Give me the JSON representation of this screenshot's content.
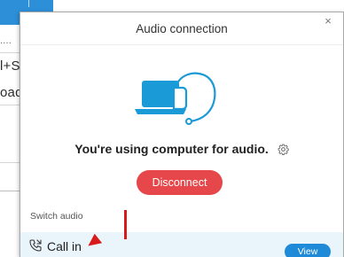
{
  "background": {
    "dots": "....",
    "line1": "l+S",
    "line2": "oad"
  },
  "dialog": {
    "title": "Audio connection",
    "close_glyph": "×",
    "status_text": "You're using computer for audio.",
    "disconnect_label": "Disconnect",
    "switch_audio_label": "Switch audio",
    "call_in_label": "Call in",
    "view_label": "View"
  },
  "icons": {
    "close": "close-icon",
    "gear": "gear-icon",
    "phone": "phone-icon",
    "illustration": "computer-headset-icon"
  },
  "colors": {
    "header_blue": "#2d8fd8",
    "disconnect_red": "#e6474a",
    "view_blue": "#1f8bd8",
    "call_in_row_bg": "#eaf4fb",
    "annotation_red": "#d91a1a"
  }
}
